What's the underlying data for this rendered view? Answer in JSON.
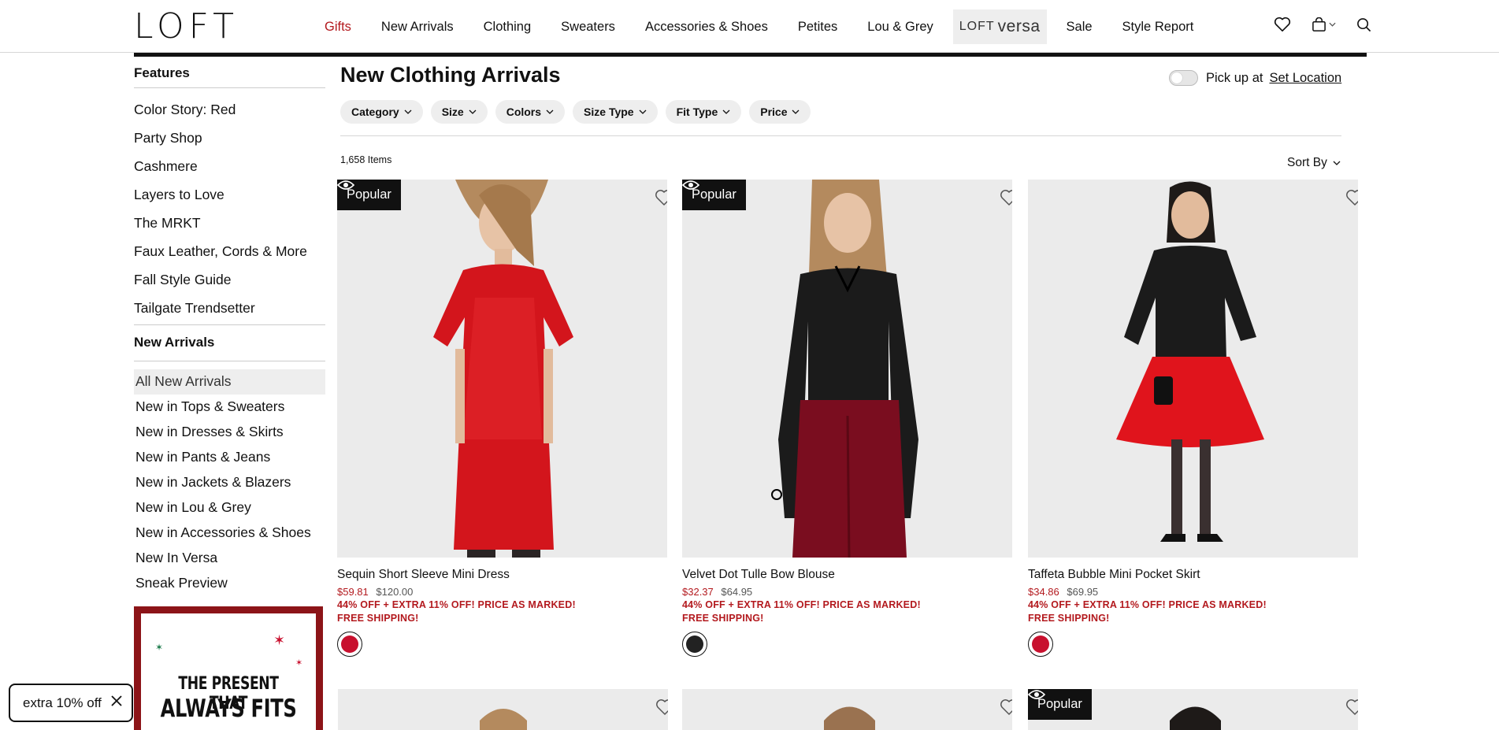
{
  "brand": {
    "logo_text": "LOFT"
  },
  "nav": {
    "items": [
      {
        "label": "Gifts",
        "active": true
      },
      {
        "label": "New Arrivals"
      },
      {
        "label": "Clothing"
      },
      {
        "label": "Sweaters"
      },
      {
        "label": "Accessories & Shoes"
      },
      {
        "label": "Petites"
      },
      {
        "label": "Lou & Grey"
      },
      {
        "label_a": "LOFT",
        "label_b": "versa"
      },
      {
        "label": "Sale"
      },
      {
        "label": "Style Report"
      }
    ],
    "icons": [
      "heart-icon",
      "bag-icon",
      "chevron-down-icon",
      "search-icon"
    ]
  },
  "sidebar": {
    "features_heading": "Features",
    "features": [
      "Color Story: Red",
      "Party Shop",
      "Cashmere",
      "Layers to Love",
      "The MRKT",
      "Faux Leather, Cords & More",
      "Fall Style Guide",
      "Tailgate Trendsetter"
    ],
    "new_heading": "New Arrivals",
    "new_items": [
      "All New Arrivals",
      "New in Tops & Sweaters",
      "New in Dresses & Skirts",
      "New in Pants & Jeans",
      "New in Jackets & Blazers",
      "New in Lou & Grey",
      "New in Accessories & Shoes",
      "New In Versa",
      "Sneak Preview"
    ],
    "promo": {
      "line1": "THE PRESENT THAT",
      "line2": "ALWAYS FITS"
    }
  },
  "offer_pill": {
    "label": "extra 10% off"
  },
  "main": {
    "title": "New Clothing Arrivals",
    "pickup_label": "Pick up at",
    "set_location": "Set Location",
    "filters": [
      "Category",
      "Size",
      "Colors",
      "Size Type",
      "Fit Type",
      "Price"
    ],
    "count": "1,658 Items",
    "sort_label": "Sort By"
  },
  "products": [
    {
      "badge": "Popular",
      "name": "Sequin Short Sleeve Mini Dress",
      "sale_price": "$59.81",
      "orig_price": "$120.00",
      "promo": "44% OFF + EXTRA 11% OFF! PRICE AS MARKED!",
      "shipping": "FREE SHIPPING!",
      "swatch": "#c8102e"
    },
    {
      "badge": "Popular",
      "name": "Velvet Dot Tulle Bow Blouse",
      "sale_price": "$32.37",
      "orig_price": "$64.95",
      "promo": "44% OFF + EXTRA 11% OFF! PRICE AS MARKED!",
      "shipping": "FREE SHIPPING!",
      "swatch": "#222222"
    },
    {
      "badge": "",
      "name": "Taffeta Bubble Mini Pocket Skirt",
      "sale_price": "$34.86",
      "orig_price": "$69.95",
      "promo": "44% OFF + EXTRA 11% OFF! PRICE AS MARKED!",
      "shipping": "FREE SHIPPING!",
      "swatch": "#c8102e"
    }
  ],
  "second_row": {
    "badge": "Popular"
  },
  "colors": {
    "accent_red": "#b3191e",
    "black": "#111111"
  }
}
